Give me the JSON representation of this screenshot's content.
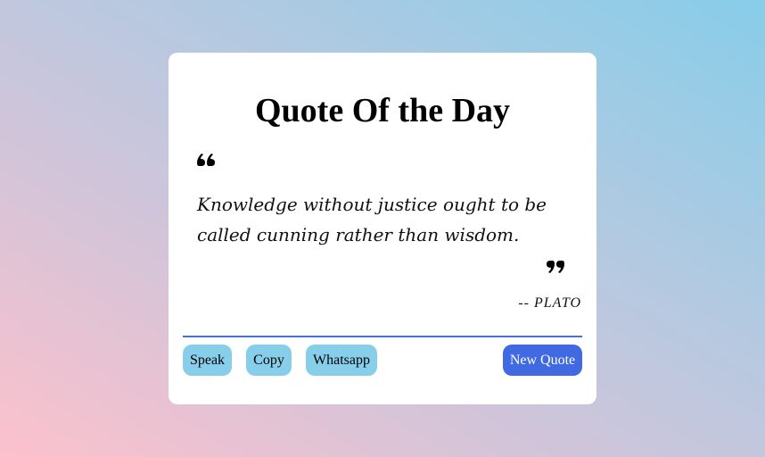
{
  "card": {
    "title": "Quote Of the Day",
    "quote": "Knowledge without justice ought to be called cunning rather than wisdom.",
    "author": "-- PLATO",
    "open_quote_icon": "quote-left-icon",
    "close_quote_icon": "quote-right-icon"
  },
  "actions": {
    "speak_label": "Speak",
    "copy_label": "Copy",
    "whatsapp_label": "Whatsapp",
    "new_quote_label": "New Quote"
  },
  "colors": {
    "accent": "#4169e1",
    "button_light": "#87ceeb",
    "background_gradient_start": "#fcc1cc",
    "background_gradient_end": "#87cde9"
  }
}
